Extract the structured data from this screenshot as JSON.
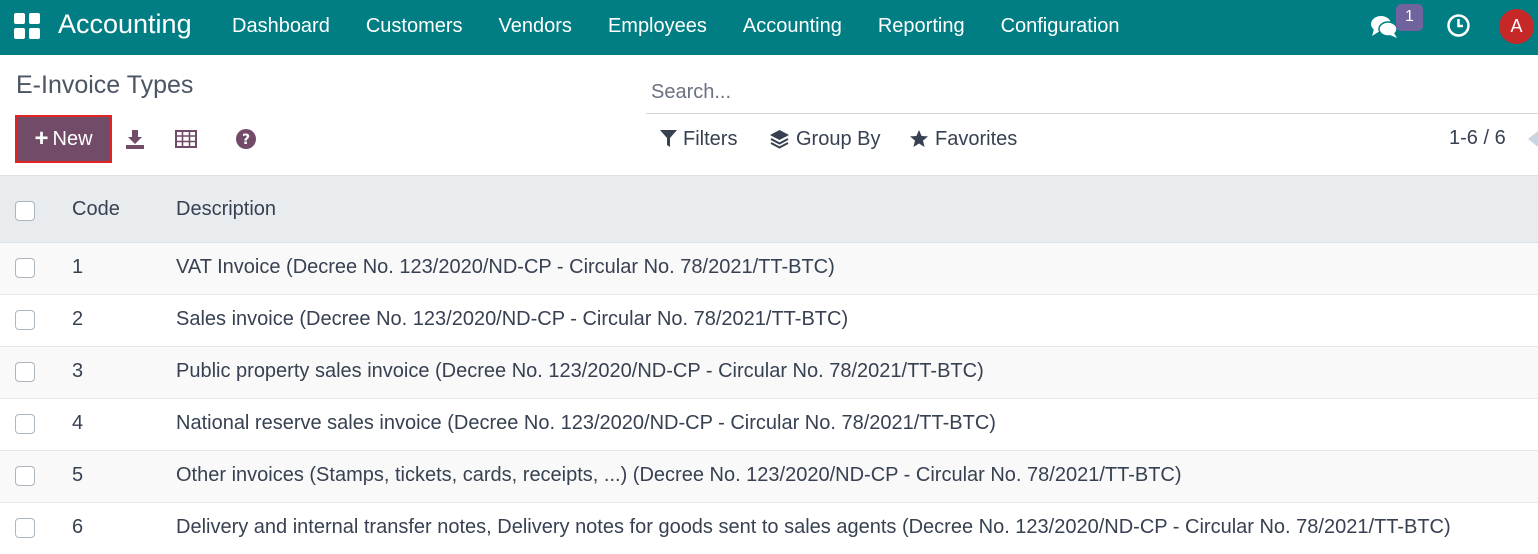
{
  "navbar": {
    "app_title": "Accounting",
    "menu": [
      "Dashboard",
      "Customers",
      "Vendors",
      "Employees",
      "Accounting",
      "Reporting",
      "Configuration"
    ],
    "message_count": "1",
    "avatar_initial": "A",
    "color": "#017e84"
  },
  "control_panel": {
    "page_title": "E-Invoice Types",
    "new_label": "New",
    "search_placeholder": "Search...",
    "filters_label": "Filters",
    "group_by_label": "Group By",
    "favorites_label": "Favorites",
    "pager": "1-6 / 6",
    "accent": "#714b67"
  },
  "table": {
    "headers": {
      "code": "Code",
      "description": "Description"
    },
    "rows": [
      {
        "code": "1",
        "description": "VAT Invoice (Decree No. 123/2020/ND-CP - Circular No. 78/2021/TT-BTC)"
      },
      {
        "code": "2",
        "description": "Sales invoice (Decree No. 123/2020/ND-CP - Circular No. 78/2021/TT-BTC)"
      },
      {
        "code": "3",
        "description": "Public property sales invoice (Decree No. 123/2020/ND-CP - Circular No. 78/2021/TT-BTC)"
      },
      {
        "code": "4",
        "description": "National reserve sales invoice (Decree No. 123/2020/ND-CP - Circular No. 78/2021/TT-BTC)"
      },
      {
        "code": "5",
        "description": "Other invoices (Stamps, tickets, cards, receipts, ...) (Decree No. 123/2020/ND-CP - Circular No. 78/2021/TT-BTC)"
      },
      {
        "code": "6",
        "description": "Delivery and internal transfer notes, Delivery notes for goods sent to sales agents (Decree No. 123/2020/ND-CP - Circular No. 78/2021/TT-BTC)"
      }
    ]
  },
  "icons": [
    "apps-icon",
    "chat-icon",
    "clock-icon",
    "download-icon",
    "table-icon",
    "help-icon",
    "filter-icon",
    "layers-icon",
    "star-icon"
  ]
}
